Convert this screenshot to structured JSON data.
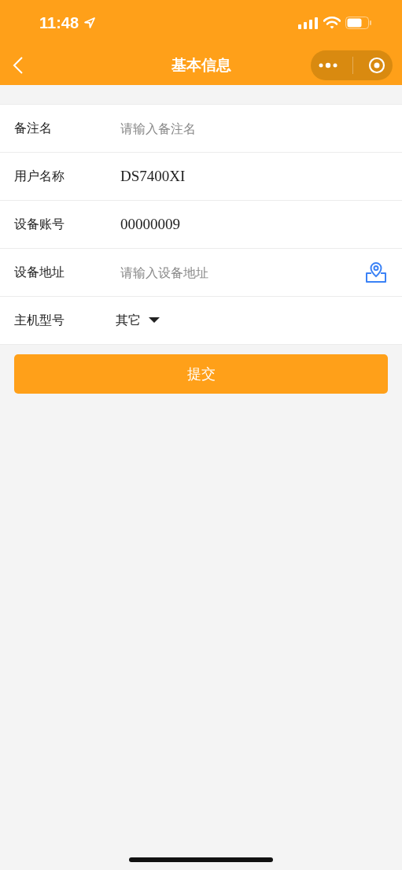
{
  "status_bar": {
    "time": "11:48"
  },
  "nav_bar": {
    "title": "基本信息"
  },
  "rows": [
    {
      "kind": "text",
      "label": "备注名",
      "placeholder": "请输入备注名"
    },
    {
      "kind": "text",
      "label": "用户名称",
      "value": "DS7400XI"
    },
    {
      "kind": "text",
      "label": "设备账号",
      "value": "00000009"
    },
    {
      "kind": "location",
      "label": "设备地址",
      "placeholder": "请输入设备地址"
    },
    {
      "kind": "select",
      "label": "主机型号",
      "value": "其它"
    }
  ],
  "submit_button": "提交"
}
